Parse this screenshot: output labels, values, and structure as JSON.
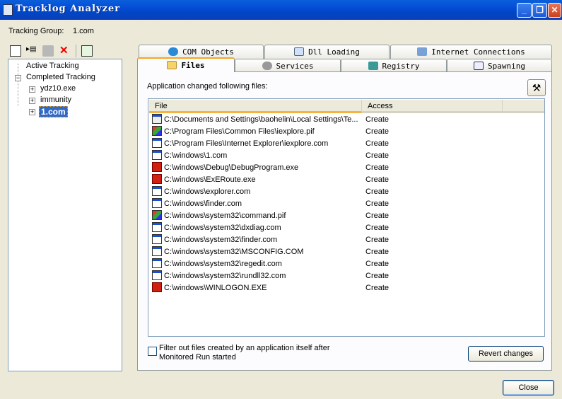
{
  "window": {
    "title": "Tracklog Analyzer",
    "min": "_",
    "max": "❐",
    "close": "✕"
  },
  "group": {
    "label": "Tracking Group:",
    "value": "1.com"
  },
  "toolbar": {
    "icons": [
      "tree-view-icon",
      "run-list-icon",
      "stop-icon",
      "delete-icon",
      "refresh-icon"
    ],
    "delete_glyph": "✕"
  },
  "tree": {
    "active": "Active Tracking",
    "completed": "Completed Tracking",
    "children": [
      "ydz10.exe",
      "immunity",
      "1.com"
    ],
    "selected": "1.com"
  },
  "tabs_row1": [
    "COM Objects",
    "Dll Loading",
    "Internet Connections"
  ],
  "tabs_row2": [
    "Files",
    "Services",
    "Registry",
    "Spawning"
  ],
  "selected_tab": "Files",
  "files": {
    "caption": "Application changed following files:",
    "columns": [
      "File",
      "Access"
    ],
    "rows": [
      {
        "icon": "bat",
        "file": "C:\\Documents and Settings\\baohelin\\Local Settings\\Te...",
        "access": "Create"
      },
      {
        "icon": "pif",
        "file": "C:\\Program Files\\Common Files\\iexplore.pif",
        "access": "Create"
      },
      {
        "icon": "exe",
        "file": "C:\\Program Files\\Internet Explorer\\iexplore.com",
        "access": "Create"
      },
      {
        "icon": "exe",
        "file": "C:\\windows\\1.com",
        "access": "Create"
      },
      {
        "icon": "red",
        "file": "C:\\windows\\Debug\\DebugProgram.exe",
        "access": "Create"
      },
      {
        "icon": "red",
        "file": "C:\\windows\\ExERoute.exe",
        "access": "Create"
      },
      {
        "icon": "exe",
        "file": "C:\\windows\\explorer.com",
        "access": "Create"
      },
      {
        "icon": "exe",
        "file": "C:\\windows\\finder.com",
        "access": "Create"
      },
      {
        "icon": "pif",
        "file": "C:\\windows\\system32\\command.pif",
        "access": "Create"
      },
      {
        "icon": "exe",
        "file": "C:\\windows\\system32\\dxdiag.com",
        "access": "Create"
      },
      {
        "icon": "exe",
        "file": "C:\\windows\\system32\\finder.com",
        "access": "Create"
      },
      {
        "icon": "exe",
        "file": "C:\\windows\\system32\\MSCONFIG.COM",
        "access": "Create"
      },
      {
        "icon": "exe",
        "file": "C:\\windows\\system32\\regedit.com",
        "access": "Create"
      },
      {
        "icon": "exe",
        "file": "C:\\windows\\system32\\rundll32.com",
        "access": "Create"
      },
      {
        "icon": "red",
        "file": "C:\\windows\\WINLOGON.EXE",
        "access": "Create"
      }
    ],
    "filter_label_1": "Filter out files created by an application itself after",
    "filter_label_2": "Monitored Run started",
    "filter_checked": false,
    "revert": "Revert changes"
  },
  "close": "Close"
}
